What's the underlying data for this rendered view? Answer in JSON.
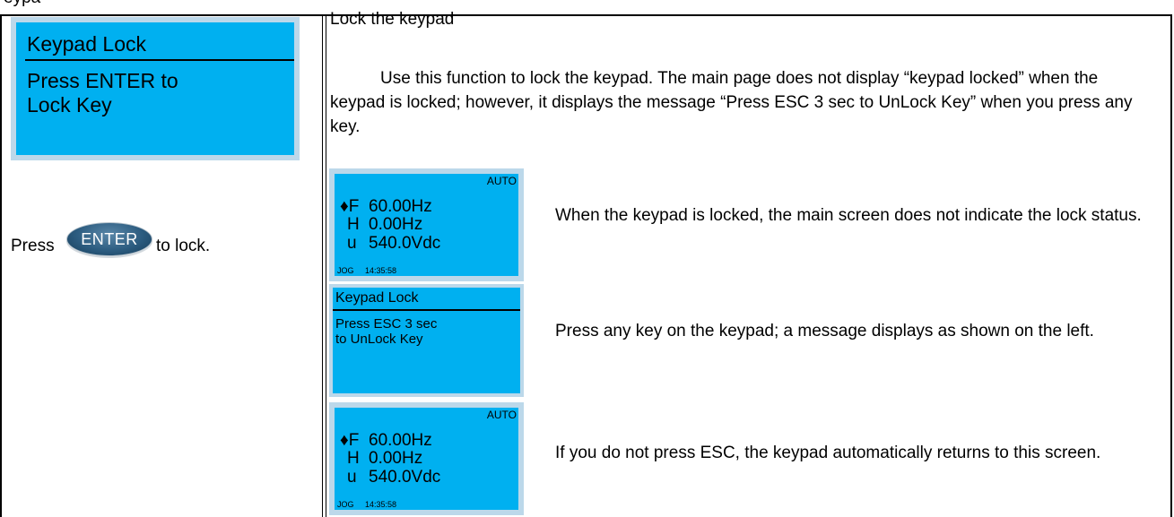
{
  "heading_cut": "eypa",
  "left": {
    "lcd": {
      "title": "Keypad Lock",
      "line1": "Press ENTER to",
      "line2": "Lock Key"
    },
    "press_text": "Press",
    "enter_label": "ENTER",
    "to_lock_text": "to lock."
  },
  "right": {
    "title": "Lock the keypad",
    "paragraph": "Use this function to lock the keypad. The main page does not display “keypad locked” when the keypad is locked; however, it displays the message “Press ESC 3 sec to UnLock Key” when you press any key.",
    "screen1": {
      "mode": "AUTO",
      "rows": [
        {
          "label": "♦F",
          "value": "60.00Hz"
        },
        {
          "label": "H",
          "value": "0.00Hz"
        },
        {
          "label": "u",
          "value": "540.0Vdc"
        }
      ],
      "jog": "JOG",
      "time": "14:35:58"
    },
    "desc1": "When the keypad is locked, the main screen does not indicate the lock status.",
    "screen2": {
      "title": "Keypad Lock",
      "line1": "Press ESC 3 sec",
      "line2": "to UnLock Key"
    },
    "desc2": "Press any key on the keypad; a message displays as shown on the left.",
    "screen3": {
      "mode": "AUTO",
      "rows": [
        {
          "label": "♦F",
          "value": "60.00Hz"
        },
        {
          "label": "H",
          "value": "0.00Hz"
        },
        {
          "label": "u",
          "value": "540.0Vdc"
        }
      ],
      "jog": "JOG",
      "time": "14:35:58"
    },
    "desc3": "If you do not press ESC, the keypad automatically returns to this screen."
  },
  "colors": {
    "lcd_blue": "#00b0f0",
    "lcd_border": "#bcd8ea",
    "button_blue": "#2c5c80"
  }
}
